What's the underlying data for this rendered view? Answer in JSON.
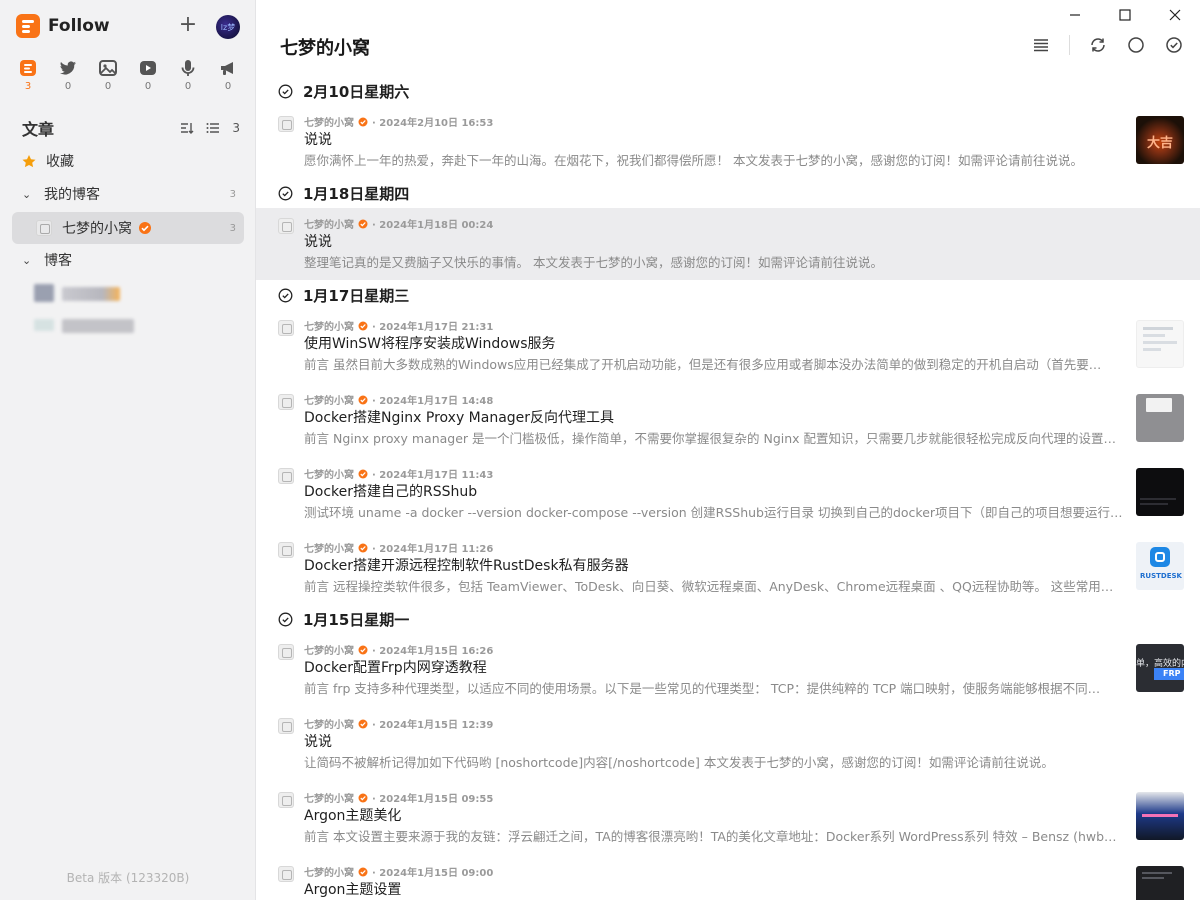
{
  "app": {
    "name": "Follow",
    "beta": "Beta 版本 (123320B)"
  },
  "avatar_text": "lz梦",
  "views": [
    {
      "icon": "article-icon",
      "count": "3",
      "active": true
    },
    {
      "icon": "twitter-icon",
      "count": "0"
    },
    {
      "icon": "picture-icon",
      "count": "0"
    },
    {
      "icon": "video-icon",
      "count": "0"
    },
    {
      "icon": "microphone-icon",
      "count": "0"
    },
    {
      "icon": "megaphone-icon",
      "count": "0"
    }
  ],
  "section": {
    "title": "文章",
    "count": "3"
  },
  "nav": {
    "favorites": "收藏",
    "group1": {
      "label": "我的博客",
      "count": "3"
    },
    "feed": {
      "label": "七梦的小窝",
      "count": "3"
    },
    "group2": {
      "label": "博客"
    }
  },
  "main": {
    "title": "七梦的小窝"
  },
  "days": [
    {
      "title": "2月10日星期六"
    },
    {
      "title": "1月18日星期四"
    },
    {
      "title": "1月17日星期三"
    },
    {
      "title": "1月15日星期一"
    }
  ],
  "entries": [
    {
      "source": "七梦的小窝",
      "time": "· 2024年2月10日 16:53",
      "title": "说说",
      "desc": "愿你满怀上一年的热爱，奔赴下一年的山海。在烟花下，祝我们都得偿所愿！ 本文发表于七梦的小窝，感谢您的订阅！如需评论请前往说说。",
      "thumb": "fireworks"
    },
    {
      "source": "七梦的小窝",
      "time": "· 2024年1月18日 00:24",
      "title": "说说",
      "desc": "整理笔记真的是又费脑子又快乐的事情。 本文发表于七梦的小窝，感谢您的订阅！如需评论请前往说说。",
      "thumb": ""
    },
    {
      "source": "七梦的小窝",
      "time": "· 2024年1月17日 21:31",
      "title": "使用WinSW将程序安装成Windows服务",
      "desc": "前言 虽然目前大多数成熟的Windows应用已经集成了开机启动功能，但是还有很多应用或者脚本没办法简单的做到稳定的开机自启动（首先要…",
      "thumb": "doc-light"
    },
    {
      "source": "七梦的小窝",
      "time": "· 2024年1月17日 14:48",
      "title": "Docker搭建Nginx Proxy Manager反向代理工具",
      "desc": "前言 Nginx proxy manager 是一个门槛极低，操作简单，不需要你掌握很复杂的 Nginx 配置知识，只需要几步就能很轻松完成反向代理的设置…",
      "thumb": "gray-window"
    },
    {
      "source": "七梦的小窝",
      "time": "· 2024年1月17日 11:43",
      "title": "Docker搭建自己的RSShub",
      "desc": "测试环境 uname -a docker --version docker-compose --version 创建RSShub运行目录 切换到自己的docker项目下（即自己的项目想要运行的…",
      "thumb": "terminal"
    },
    {
      "source": "七梦的小窝",
      "time": "· 2024年1月17日 11:26",
      "title": "Docker搭建开源远程控制软件RustDesk私有服务器",
      "desc": "前言 远程操控类软件很多，包括 TeamViewer、ToDesk、向日葵、微软远程桌面、AnyDesk、Chrome远程桌面 、QQ远程协助等。 这些常用…",
      "thumb": "rustdesk"
    },
    {
      "source": "七梦的小窝",
      "time": "· 2024年1月15日 16:26",
      "title": "Docker配置Frp内网穿透教程",
      "desc": "前言 frp 支持多种代理类型，以适应不同的使用场景。以下是一些常见的代理类型： TCP：提供纯粹的 TCP 端口映射，使服务端能够根据不同…",
      "thumb": "frp"
    },
    {
      "source": "七梦的小窝",
      "time": "· 2024年1月15日 12:39",
      "title": "说说",
      "desc": "让简码不被解析记得加如下代码哟 [noshortcode]内容[/noshortcode] 本文发表于七梦的小窝，感谢您的订阅！如需评论请前往说说。",
      "thumb": ""
    },
    {
      "source": "七梦的小窝",
      "time": "· 2024年1月15日 09:55",
      "title": "Argon主题美化",
      "desc": "前言 本文设置主要来源于我的友链：浮云翩迁之间，TA的博客很漂亮哟！TA的美化文章地址：Docker系列 WordPress系列 特效 – Bensz (hwb…",
      "thumb": "argon"
    },
    {
      "source": "七梦的小窝",
      "time": "· 2024年1月15日 09:00",
      "title": "Argon主题设置",
      "desc": "",
      "thumb": "dark-doc"
    }
  ],
  "thumb_texts": {
    "fireworks": "大吉",
    "rustdesk": "RUSTDESK",
    "frp_top": "单，高效的内",
    "frp_bottom": "FRP"
  },
  "colors": {
    "accent": "#f97316",
    "selected_bg": "#ececee",
    "sidebar_bg": "#f2f2f3"
  }
}
